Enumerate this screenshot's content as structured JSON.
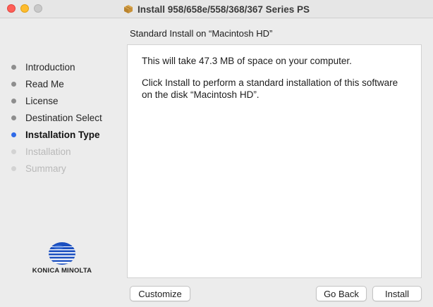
{
  "window": {
    "title": "Install 958/658e/558/368/367 Series PS",
    "icon": "package-icon",
    "controls": [
      "close",
      "minimize",
      "zoom"
    ],
    "colors": {
      "close": "#fe5f57",
      "minimize": "#febc2e",
      "zoom": "#c9c9c9"
    }
  },
  "subtitle": "Standard Install on “Macintosh HD”",
  "sidebar": {
    "steps": [
      {
        "label": "Introduction",
        "state": "done"
      },
      {
        "label": "Read Me",
        "state": "done"
      },
      {
        "label": "License",
        "state": "done"
      },
      {
        "label": "Destination Select",
        "state": "done"
      },
      {
        "label": "Installation Type",
        "state": "active"
      },
      {
        "label": "Installation",
        "state": "pending"
      },
      {
        "label": "Summary",
        "state": "pending"
      }
    ],
    "active_color": "#2f6ae8"
  },
  "brand": {
    "name": "KONICA MINOLTA",
    "logo_color": "#1b4fbf"
  },
  "content": {
    "space_text": "This will take 47.3 MB of space on your computer.",
    "install_text": "Click Install to perform a standard installation of this software on the disk “Macintosh HD”."
  },
  "buttons": {
    "customize": "Customize",
    "go_back": "Go Back",
    "install": "Install"
  }
}
